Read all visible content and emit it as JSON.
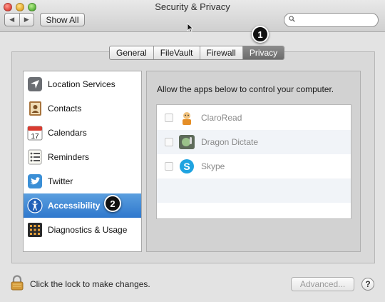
{
  "window": {
    "title": "Security & Privacy"
  },
  "toolbar": {
    "back": "◀",
    "forward": "▶",
    "show_all": "Show All",
    "search_placeholder": ""
  },
  "tabs": [
    {
      "label": "General"
    },
    {
      "label": "FileVault"
    },
    {
      "label": "Firewall"
    },
    {
      "label": "Privacy",
      "active": true
    }
  ],
  "badges": {
    "privacy": "1",
    "accessibility": "2"
  },
  "sidebar": {
    "items": [
      {
        "label": "Location Services",
        "icon": "location-arrow-icon"
      },
      {
        "label": "Contacts",
        "icon": "contacts-book-icon"
      },
      {
        "label": "Calendars",
        "icon": "calendar-icon",
        "icon_text": "17"
      },
      {
        "label": "Reminders",
        "icon": "reminders-list-icon"
      },
      {
        "label": "Twitter",
        "icon": "twitter-bird-icon"
      },
      {
        "label": "Accessibility",
        "icon": "accessibility-person-icon",
        "selected": true
      },
      {
        "label": "Diagnostics & Usage",
        "icon": "diagnostics-grid-icon"
      }
    ]
  },
  "content": {
    "heading": "Allow the apps below to control your computer.",
    "apps": [
      {
        "name": "ClaroRead",
        "checked": false,
        "icon": "claroread-icon"
      },
      {
        "name": "Dragon Dictate",
        "checked": false,
        "icon": "dragon-dictate-icon"
      },
      {
        "name": "Skype",
        "checked": false,
        "icon": "skype-icon"
      }
    ]
  },
  "footer": {
    "lock_text": "Click the lock to make changes.",
    "advanced": "Advanced...",
    "help": "?"
  },
  "colors": {
    "selection": "#2f78cd",
    "badge": "#111111",
    "tab_active": "#7a7a7a",
    "skype": "#1fa3e0"
  }
}
